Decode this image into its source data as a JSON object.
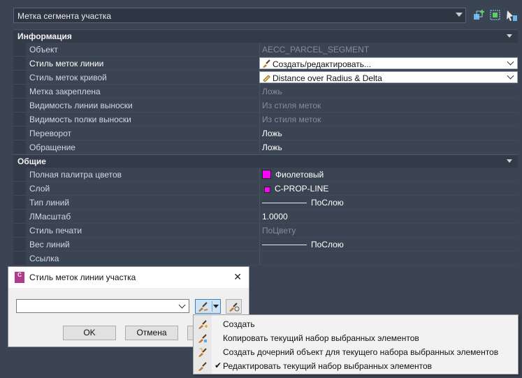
{
  "top": {
    "selector_value": "Метка сегмента участка"
  },
  "sections": {
    "info": {
      "title": "Информация",
      "rows": [
        {
          "label": "Объект",
          "value": "AECC_PARCEL_SEGMENT"
        },
        {
          "label": "Стиль меток линии",
          "value": "Создать/редактировать..."
        },
        {
          "label": "Стиль меток кривой",
          "value": "Distance over Radius & Delta"
        },
        {
          "label": "Метка закреплена",
          "value": "Ложь"
        },
        {
          "label": "Видимость линии выноски",
          "value": "Из стиля меток"
        },
        {
          "label": "Видимость полки выноски",
          "value": "Из стиля меток"
        },
        {
          "label": "Переворот",
          "value": "Ложь"
        },
        {
          "label": "Обращение",
          "value": "Ложь"
        }
      ]
    },
    "general": {
      "title": "Общие",
      "rows": [
        {
          "label": "Полная палитра цветов",
          "value": "Фиолетовый"
        },
        {
          "label": "Слой",
          "value": "C-PROP-LINE"
        },
        {
          "label": "Тип линий",
          "value": "ПоСлою"
        },
        {
          "label": "ЛМасштаб",
          "value": "1.0000"
        },
        {
          "label": "Стиль печати",
          "value": "ПоЦвету"
        },
        {
          "label": "Вес линий",
          "value": "ПоСлою"
        },
        {
          "label": "Ссылка",
          "value": ""
        }
      ]
    }
  },
  "colors": {
    "magenta": "#ff00ff",
    "accent": "#3c7fc0"
  },
  "dialog": {
    "title": "Стиль меток линии участка",
    "logo_text": "C",
    "close_label": "✕",
    "combo_value": "",
    "ok_label": "OK",
    "cancel_label": "Отмена"
  },
  "menu": {
    "items": [
      {
        "label": "Создать",
        "checked": false,
        "icon": "create-style-icon"
      },
      {
        "label": "Копировать текущий набор выбранных элементов",
        "checked": false,
        "icon": "copy-style-icon"
      },
      {
        "label": "Создать дочерний объект для текущего набора выбранных элементов",
        "checked": false,
        "icon": "child-style-icon"
      },
      {
        "label": "Редактировать текущий набор выбранных элементов",
        "checked": true,
        "icon": "edit-style-icon"
      }
    ],
    "check_mark": "✔"
  }
}
